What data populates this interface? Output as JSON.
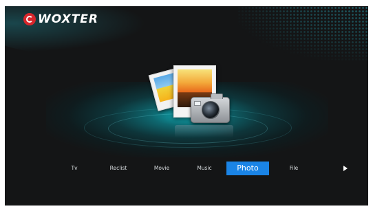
{
  "brand": {
    "name": "WOXTER",
    "color": "#d7262b"
  },
  "hero": {
    "icon": "photo-camera-icon"
  },
  "menu": {
    "items": [
      {
        "label": "Tv",
        "selected": false
      },
      {
        "label": "Reclist",
        "selected": false
      },
      {
        "label": "Movie",
        "selected": false
      },
      {
        "label": "Music",
        "selected": false
      },
      {
        "label": "Photo",
        "selected": true
      },
      {
        "label": "File",
        "selected": false
      }
    ],
    "selected_color": "#1a84e6",
    "next_icon": "play-arrow-icon"
  },
  "theme": {
    "background": "#141516",
    "glow": "#10b4be"
  }
}
